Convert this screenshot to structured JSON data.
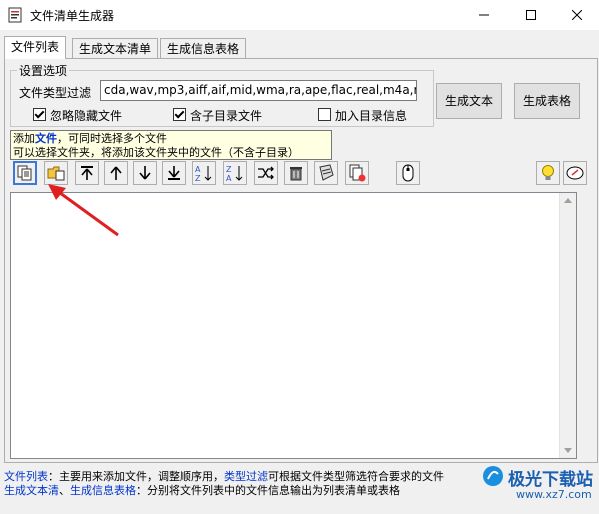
{
  "window": {
    "title": "文件清单生成器",
    "min_label": "—",
    "max_label": "☐",
    "close_label": "✕"
  },
  "tabs": [
    "文件列表",
    "生成文本清单",
    "生成信息表格"
  ],
  "settings": {
    "group_title": "设置选项",
    "filter_label": "文件类型过滤",
    "filter_value": "cda,wav,mp3,aiff,aif,mid,wma,ra,ape,flac,real,m4a,m",
    "checkboxes": [
      {
        "label": "忽略隐藏文件",
        "checked": true
      },
      {
        "label": "含子目录文件",
        "checked": true
      },
      {
        "label": "加入目录信息",
        "checked": false
      }
    ],
    "gen_text_button": "生成文本",
    "gen_table_button": "生成表格"
  },
  "tooltip": {
    "line1_a": "添加",
    "line1_b": "文件",
    "line1_c": "，可同时选择多个文件",
    "line2": "可以选择文件夹，将添加该文件夹中的文件（不含子目录）"
  },
  "toolbar_icons": [
    "add-files-icon",
    "add-folder-icon",
    "move-top-icon",
    "move-up-icon",
    "move-down-icon",
    "move-bottom-icon",
    "sort-az-icon",
    "sort-za-icon",
    "shuffle-icon",
    "delete-icon",
    "clear-icon",
    "remove-missing-icon",
    "mouse-icon",
    "tip-bulb-icon",
    "about-icon"
  ],
  "hints": {
    "line1_k1": "文件列表",
    "line1_t1": "：主要用来添加文件，调整顺序用，",
    "line1_k2": "类型过滤",
    "line1_t2": "可根据文件类型筛选符合要求的文件",
    "line2_k1": "生成文本清",
    "line2_t1": "、",
    "line2_k2": "生成信息表格",
    "line2_t2": "：分别将文件列表中的文件信息输出为列表清单或表格"
  },
  "watermark": {
    "text": "极光下载站",
    "url": "www.xz7.com"
  },
  "colors": {
    "link": "#0033cc",
    "tooltip_bg": "#ffffe1",
    "arrow": "#e02020"
  }
}
